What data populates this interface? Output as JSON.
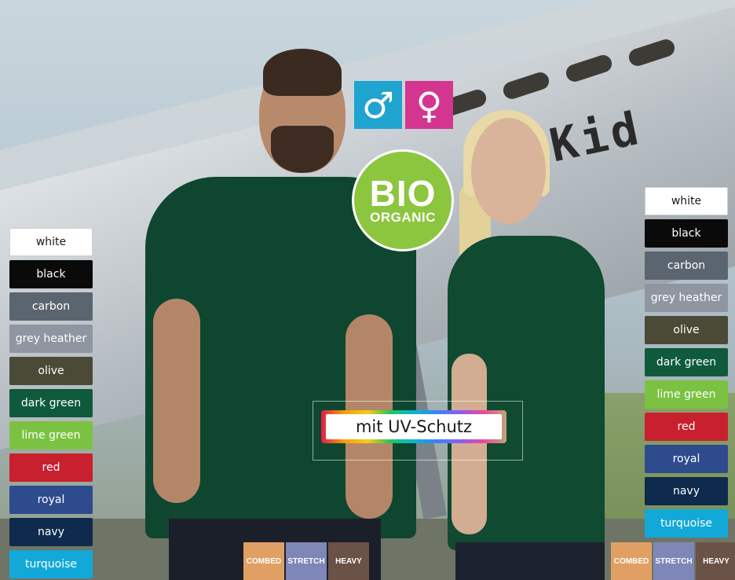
{
  "badges": {
    "gender": [
      {
        "symbol": "♂",
        "color": "#1fa3cf"
      },
      {
        "symbol": "♀",
        "color": "#d3358f"
      }
    ],
    "bio": {
      "line1": "BIO",
      "line2": "ORGANIC",
      "color": "#8cc63f"
    },
    "uv": {
      "label": "mit UV-Schutz"
    }
  },
  "swatches_left": [
    {
      "label": "white",
      "bg": "#ffffff",
      "fg": "#1a1a1a"
    },
    {
      "label": "black",
      "bg": "#0a0a0a",
      "fg": "#ffffff"
    },
    {
      "label": "carbon",
      "bg": "#5b6570",
      "fg": "#ffffff"
    },
    {
      "label": "grey heather",
      "bg": "#8f96a2",
      "fg": "#ffffff"
    },
    {
      "label": "olive",
      "bg": "#4a4a36",
      "fg": "#ffffff"
    },
    {
      "label": "dark green",
      "bg": "#0f5a3d",
      "fg": "#ffffff"
    },
    {
      "label": "lime green",
      "bg": "#7cc242",
      "fg": "#ffffff"
    },
    {
      "label": "red",
      "bg": "#c8202e",
      "fg": "#ffffff"
    },
    {
      "label": "royal",
      "bg": "#2e4b8e",
      "fg": "#ffffff"
    },
    {
      "label": "navy",
      "bg": "#0e2a4d",
      "fg": "#ffffff"
    },
    {
      "label": "turquoise",
      "bg": "#12a9d8",
      "fg": "#ffffff"
    }
  ],
  "swatches_right": [
    {
      "label": "white",
      "bg": "#ffffff",
      "fg": "#1a1a1a"
    },
    {
      "label": "black",
      "bg": "#0a0a0a",
      "fg": "#ffffff"
    },
    {
      "label": "carbon",
      "bg": "#5b6570",
      "fg": "#ffffff"
    },
    {
      "label": "grey heather",
      "bg": "#8f96a2",
      "fg": "#ffffff"
    },
    {
      "label": "olive",
      "bg": "#4a4a36",
      "fg": "#ffffff"
    },
    {
      "label": "dark green",
      "bg": "#0f5a3d",
      "fg": "#ffffff"
    },
    {
      "label": "lime green",
      "bg": "#7cc242",
      "fg": "#ffffff"
    },
    {
      "label": "red",
      "bg": "#c8202e",
      "fg": "#ffffff"
    },
    {
      "label": "royal",
      "bg": "#2e4b8e",
      "fg": "#ffffff"
    },
    {
      "label": "navy",
      "bg": "#0e2a4d",
      "fg": "#ffffff"
    },
    {
      "label": "turquoise",
      "bg": "#12a9d8",
      "fg": "#ffffff"
    }
  ],
  "features_left": [
    {
      "label": "COMBED",
      "color": "#e0a063"
    },
    {
      "label": "STRETCH",
      "color": "#7f86b8"
    },
    {
      "label": "HEAVY",
      "color": "#6b5247"
    }
  ],
  "features_right": [
    {
      "label": "COMBED",
      "color": "#e0a063"
    },
    {
      "label": "STRETCH",
      "color": "#7f86b8"
    },
    {
      "label": "HEAVY",
      "color": "#6b5247"
    }
  ],
  "photo": {
    "plane_text": "Kid"
  }
}
